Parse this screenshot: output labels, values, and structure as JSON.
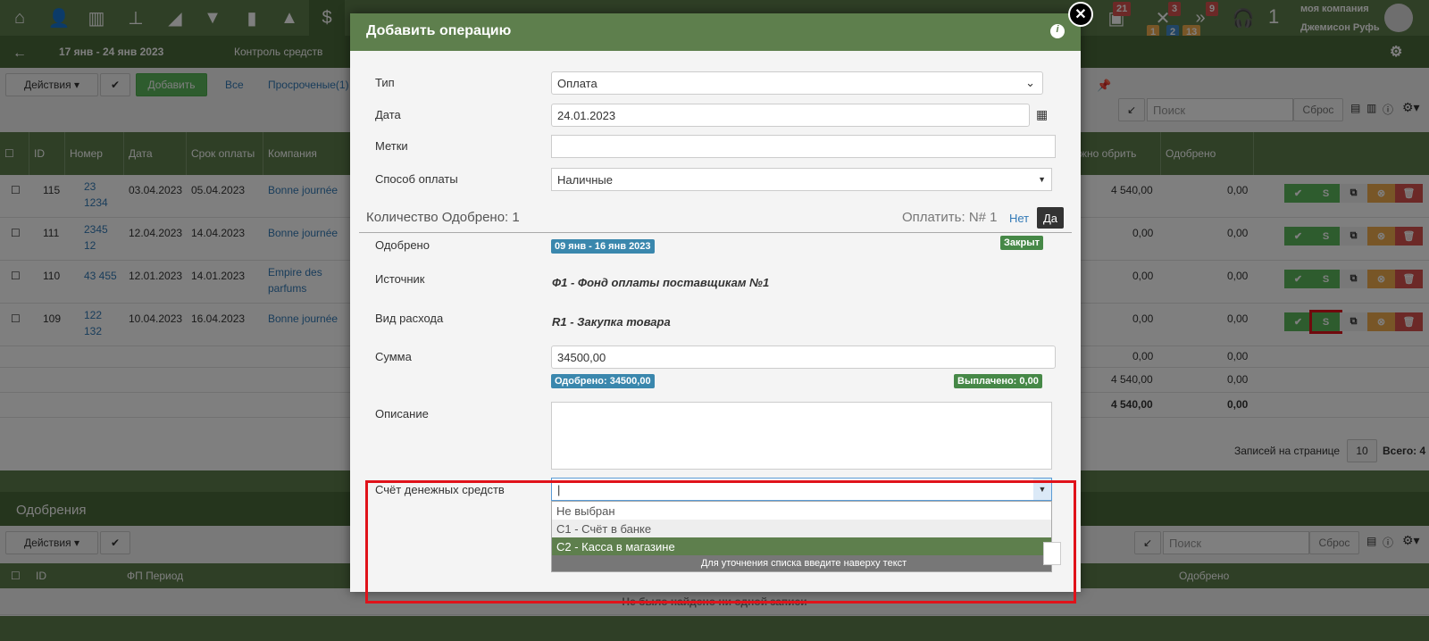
{
  "topbar": {
    "badges": {
      "b1": "21",
      "b2": "3",
      "b3": "9",
      "s1": "1",
      "s2": "2",
      "s3": "13"
    },
    "count": "1",
    "company": "моя компания",
    "user": "Джемисон Руфь"
  },
  "subbar": {
    "period": "17 янв - 24 янв 2023",
    "section": "Контроль средств"
  },
  "toolbar": {
    "actions_label": "Действия",
    "add_label": "Добавить",
    "all_label": "Все",
    "overdue_label": "Просроченые(1)",
    "search_placeholder": "Поиск",
    "reset_label": "Сброс"
  },
  "table": {
    "headers": {
      "id": "ID",
      "number": "Номер",
      "date": "Дата",
      "due": "Срок оплаты",
      "company": "Компания",
      "topay": "жно обрить",
      "approved": "Одобрено"
    },
    "rows": [
      {
        "id": "115",
        "num": "23 1234",
        "date": "03.04.2023",
        "due": "05.04.2023",
        "company": "Bonne journée",
        "amount": "4 540,00",
        "approved": "0,00"
      },
      {
        "id": "111",
        "num": "2345 12",
        "date": "12.04.2023",
        "due": "14.04.2023",
        "company": "Bonne journée",
        "amount": "0,00",
        "approved": "0,00"
      },
      {
        "id": "110",
        "num": "43 455",
        "date": "12.01.2023",
        "due": "14.01.2023",
        "company": "Empire des parfums",
        "amount": "0,00",
        "approved": "0,00"
      },
      {
        "id": "109",
        "num": "122 132",
        "date": "10.04.2023",
        "due": "16.04.2023",
        "company": "Bonne journée",
        "amount": "0,00",
        "approved": "0,00"
      }
    ],
    "totals": [
      {
        "amount": "0,00",
        "approved": "0,00"
      },
      {
        "amount": "4 540,00",
        "approved": "0,00"
      },
      {
        "amount": "4 540,00",
        "approved": "0,00"
      }
    ],
    "per_page_label": "Записей на странице",
    "per_page": "10",
    "total_label": "Всего: 4"
  },
  "approvals": {
    "title": "Одобрения",
    "actions_label": "Действия",
    "search_placeholder": "Поиск",
    "reset_label": "Сброс",
    "headers": {
      "id": "ID",
      "period": "ФП Период",
      "approved": "Одобрено"
    },
    "empty": "Не было найдено ни одной записи"
  },
  "modal": {
    "title": "Добавить операцию",
    "type_label": "Тип",
    "type_value": "Оплата",
    "date_label": "Дата",
    "date_value": "24.01.2023",
    "tags_label": "Метки",
    "method_label": "Способ оплаты",
    "method_value": "Наличные",
    "count_label": "Количество Одобрено: 1",
    "pay_label": "Оплатить: N# 1",
    "no_label": "Нет",
    "yes_label": "Да",
    "approved_label": "Одобрено",
    "period_badge": "09 янв - 16 янв 2023",
    "closed_badge": "Закрыт",
    "source_label": "Источник",
    "source_value": "Ф1 - Фонд оплаты поставщикам №1",
    "expense_label": "Вид расхода",
    "expense_value": "R1 - Закупка товара",
    "sum_label": "Сумма",
    "sum_value": "34500,00",
    "approved_sum": "Одобрено: 34500,00",
    "paid_sum": "Выплачено: 0,00",
    "desc_label": "Описание",
    "account_label": "Счёт денежных средств",
    "account_value": "|",
    "options": [
      "Не выбран",
      "С1 - Счёт в банке",
      "С2 - Касса в магазине"
    ],
    "hint": "Для уточнения списка введите наверху текст"
  },
  "colors": {
    "brand": "#5e7f4d",
    "highlight": "#e0121a",
    "blue_badge": "#3a87ad",
    "green_badge": "#468847"
  }
}
